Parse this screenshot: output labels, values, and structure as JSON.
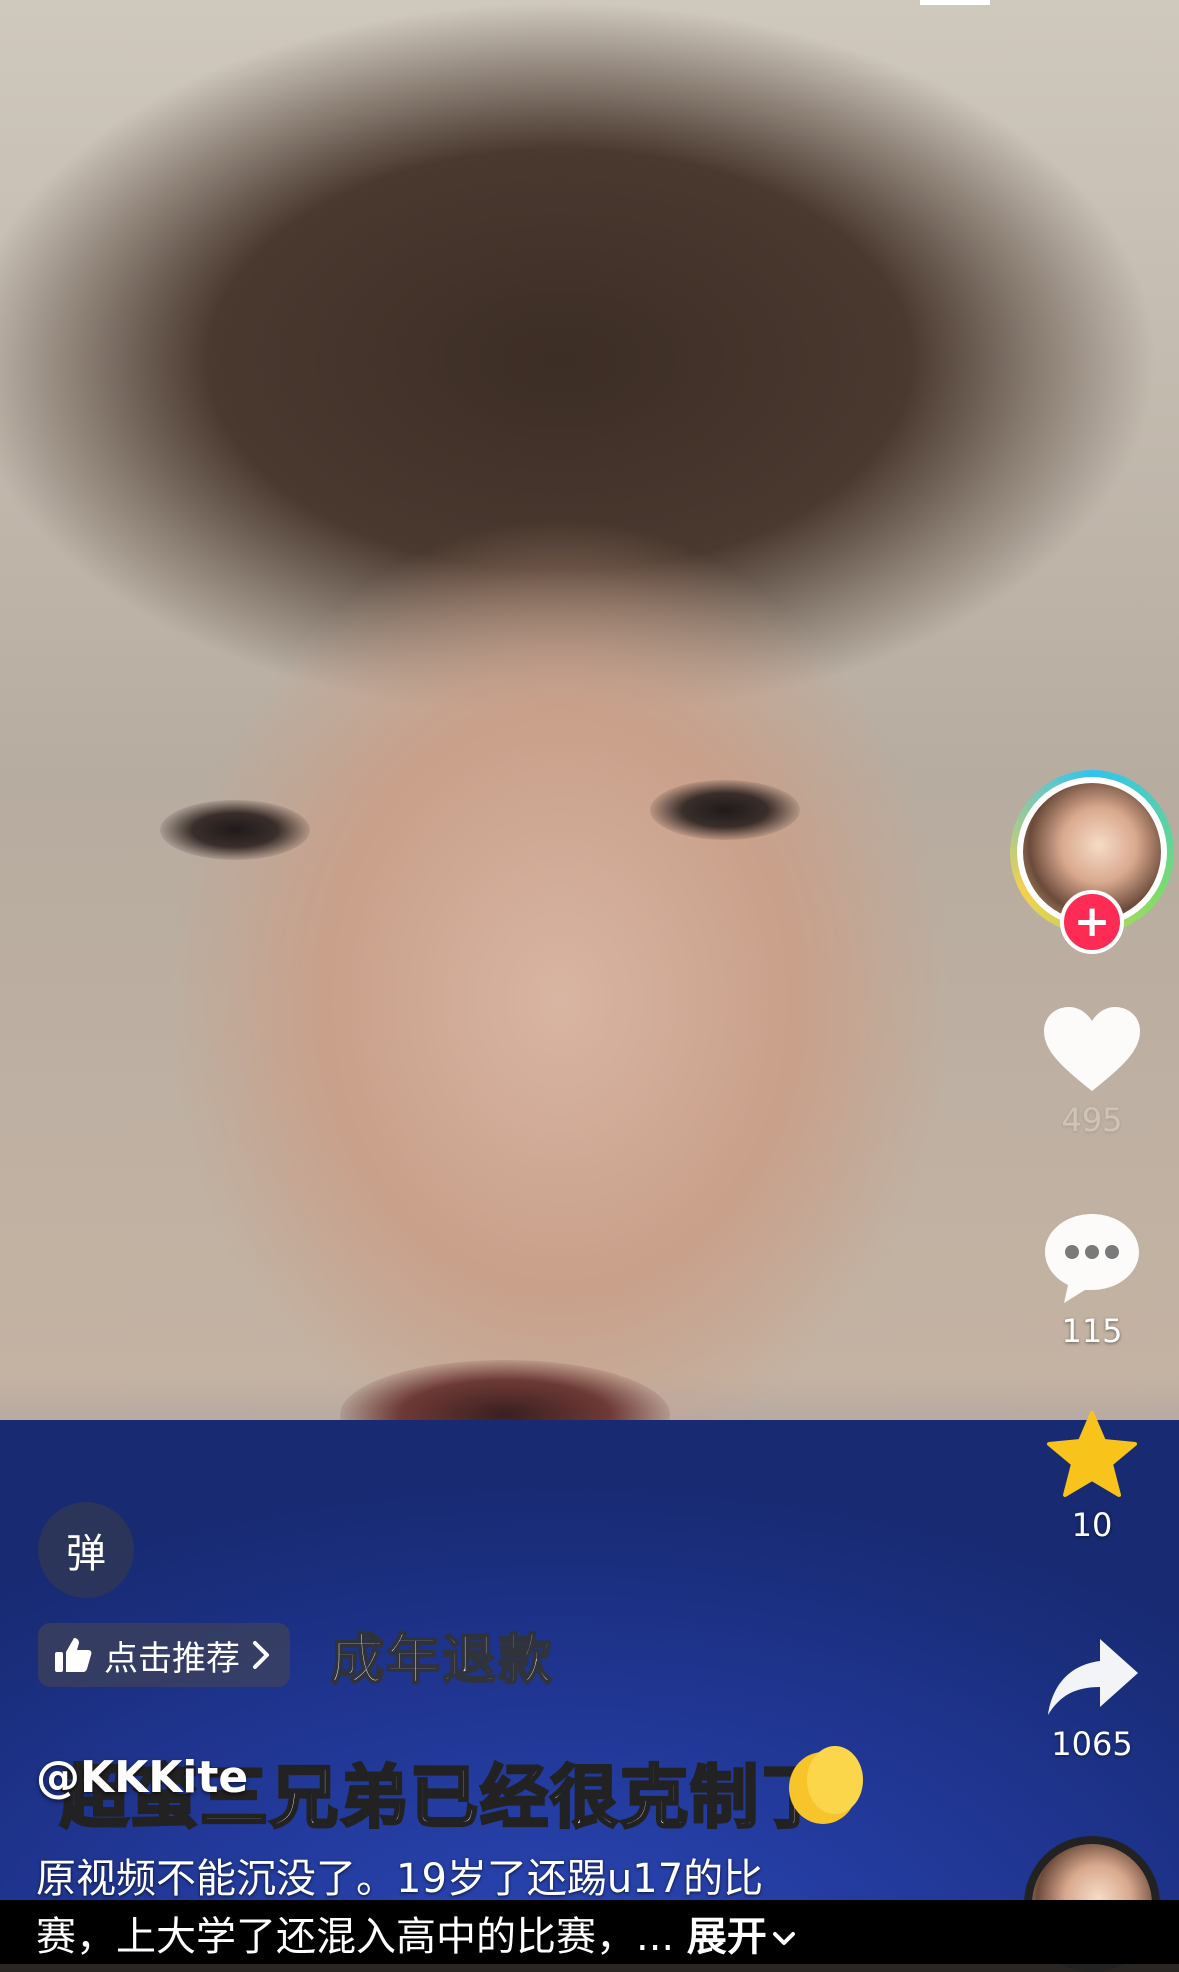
{
  "rail": {
    "like_count": "495",
    "comment_count": "115",
    "favorite_count": "10",
    "share_count": "1065",
    "follow_symbol": "+"
  },
  "overlays": {
    "danmu_label": "弹",
    "recommend_label": "点击推荐",
    "burned_subtitle_top": "成年退款",
    "burned_subtitle_main": "超蛮三兄弟已经很克制了"
  },
  "post": {
    "author": "@KKKite",
    "caption_line1": "原视频不能沉没了。19岁了还踢u17的比",
    "caption_line2": "赛，上大学了还混入高中的比赛，... ",
    "expand_label": "展开"
  },
  "icons": {
    "follow": "plus-icon",
    "like": "heart-icon",
    "comment": "comment-bubble-icon",
    "favorite": "star-icon",
    "share": "share-arrow-icon",
    "recommend": "thumbs-up-icon",
    "expand": "chevron-down-icon"
  },
  "colors": {
    "follow_red": "#fe2c55",
    "star_yellow": "#f8c41b",
    "ring_cyan": "#2ec4f1"
  }
}
